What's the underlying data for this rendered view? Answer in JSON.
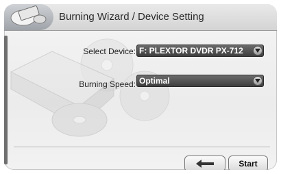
{
  "title": "Burning Wizard / Device Setting",
  "select_device": {
    "label": "Select Device:",
    "value": "F: PLEXTOR DVDR   PX-712"
  },
  "burning_speed": {
    "label": "Burning Speed:",
    "value": "Optimal"
  },
  "buttons": {
    "back_icon": "left-arrow-icon",
    "start_label": "Start"
  },
  "colors": {
    "dropdown_bg": "#4a4a4a",
    "titlebar": "#d6d6d6",
    "accent": "#9ea3a9"
  }
}
